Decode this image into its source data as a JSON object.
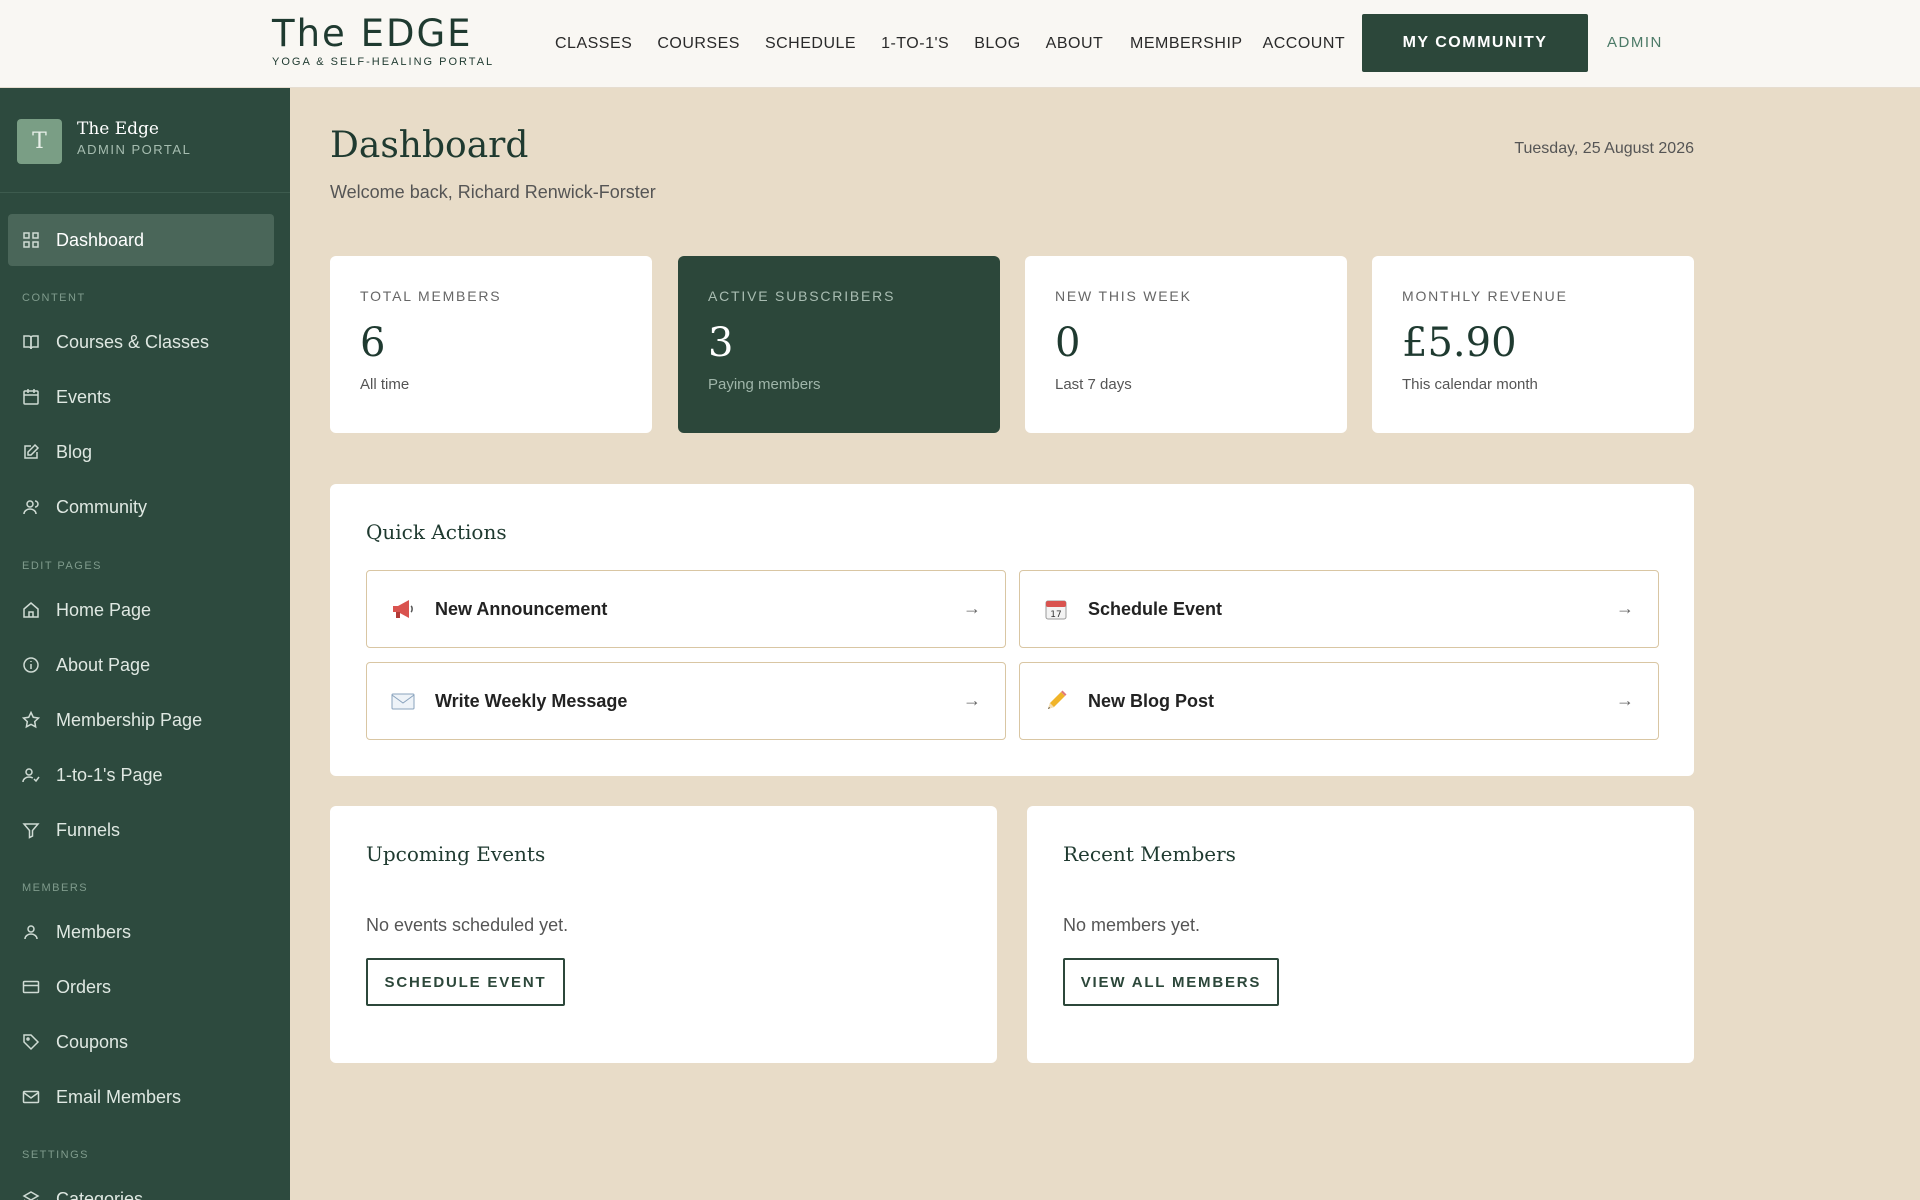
{
  "header": {
    "logo_title": "The EDGE",
    "logo_subtitle": "YOGA & SELF-HEALING PORTAL",
    "nav_main": [
      "CLASSES",
      "COURSES",
      "SCHEDULE",
      "1-TO-1'S",
      "BLOG",
      "ABOUT"
    ],
    "nav_right": [
      "MEMBERSHIP",
      "ACCOUNT"
    ],
    "community_button": "MY COMMUNITY",
    "admin_link": "ADMIN"
  },
  "sidebar": {
    "avatar_letter": "T",
    "site_name": "The Edge",
    "site_role": "ADMIN PORTAL",
    "dashboard_label": "Dashboard",
    "sections": {
      "content": "CONTENT",
      "edit_pages": "EDIT PAGES",
      "members": "MEMBERS",
      "settings": "SETTINGS"
    },
    "content_items": [
      "Courses & Classes",
      "Events",
      "Blog",
      "Community"
    ],
    "edit_page_items": [
      "Home Page",
      "About Page",
      "Membership Page",
      "1-to-1's Page",
      "Funnels"
    ],
    "member_items": [
      "Members",
      "Orders",
      "Coupons",
      "Email Members"
    ],
    "settings_items": [
      "Categories"
    ]
  },
  "main": {
    "title": "Dashboard",
    "welcome": "Welcome back, Richard Renwick-Forster",
    "date": "Tuesday, 25 August 2026",
    "stats": [
      {
        "label": "TOTAL MEMBERS",
        "value": "6",
        "sub": "All time"
      },
      {
        "label": "ACTIVE SUBSCRIBERS",
        "value": "3",
        "sub": "Paying members"
      },
      {
        "label": "NEW THIS WEEK",
        "value": "0",
        "sub": "Last 7 days"
      },
      {
        "label": "MONTHLY REVENUE",
        "value": "£5.90",
        "sub": "This calendar month"
      }
    ],
    "quick_actions": {
      "title": "Quick Actions",
      "items": [
        {
          "label": "New Announcement",
          "icon": "megaphone-icon"
        },
        {
          "label": "Schedule Event",
          "icon": "calendar-icon"
        },
        {
          "label": "Write Weekly Message",
          "icon": "envelope-icon"
        },
        {
          "label": "New Blog Post",
          "icon": "pencil-icon"
        }
      ]
    },
    "upcoming_events": {
      "title": "Upcoming Events",
      "empty": "No events scheduled yet.",
      "button": "SCHEDULE EVENT"
    },
    "recent_members": {
      "title": "Recent Members",
      "empty": "No members yet.",
      "button": "VIEW ALL MEMBERS"
    }
  },
  "colors": {
    "sidebar_bg": "#2d4a3e",
    "accent_dark_green": "#2c473a",
    "page_bg": "#e8dcc8",
    "admin_link": "#4c7a67"
  }
}
